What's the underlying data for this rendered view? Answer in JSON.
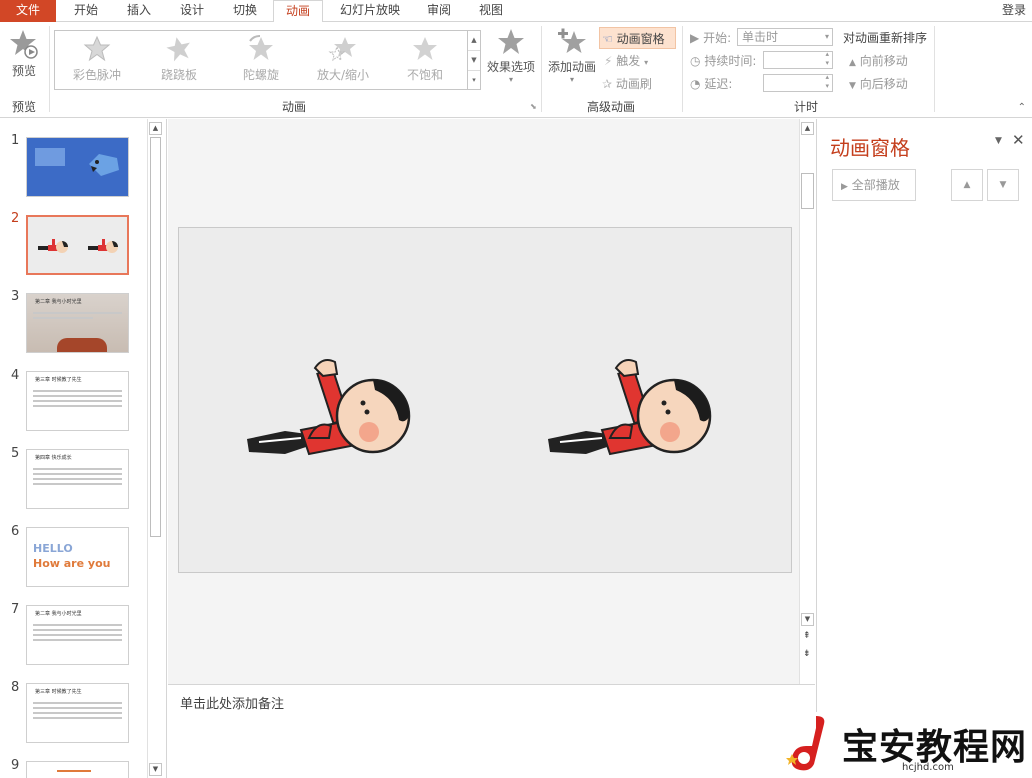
{
  "tabs": [
    "文件",
    "开始",
    "插入",
    "设计",
    "切换",
    "动画",
    "幻灯片放映",
    "审阅",
    "视图"
  ],
  "login": "登录",
  "ribbon": {
    "preview": {
      "label": "预览",
      "group": "预览"
    },
    "gallery": {
      "items": [
        "彩色脉冲",
        "跷跷板",
        "陀螺旋",
        "放大/缩小",
        "不饱和"
      ],
      "group": "动画"
    },
    "effect_options": "效果选项",
    "advanced": {
      "add_animation": "添加动画",
      "animation_pane": "动画窗格",
      "trigger": "触发",
      "painter": "动画刷",
      "group": "高级动画"
    },
    "timing": {
      "start_label": "开始:",
      "start_value": "单击时",
      "duration_label": "持续时间:",
      "delay_label": "延迟:",
      "group": "计时"
    },
    "reorder": {
      "title": "对动画重新排序",
      "forward": "向前移动",
      "backward": "向后移动"
    }
  },
  "slides": [
    "1",
    "2",
    "3",
    "4",
    "5",
    "6",
    "7",
    "8",
    "9"
  ],
  "thumb_texts": {
    "s3": "第二章 我与小时光里",
    "s4": "第三章 时候教了先生",
    "s5": "第四章 快乐成长",
    "s6a": "HELLO",
    "s6b": "How are you",
    "s7": "第二章 我与小时光里",
    "s8": "第三章 时候教了先生"
  },
  "notes_placeholder": "单击此处添加备注",
  "anim_pane": {
    "title": "动画窗格",
    "play_all": "全部播放"
  },
  "watermark": {
    "text": "宝安教程网",
    "url": "hcjhd.com"
  },
  "colors": {
    "accent": "#d24726",
    "pane_title": "#c43e1c",
    "selected_thumb": "#e8775a"
  }
}
